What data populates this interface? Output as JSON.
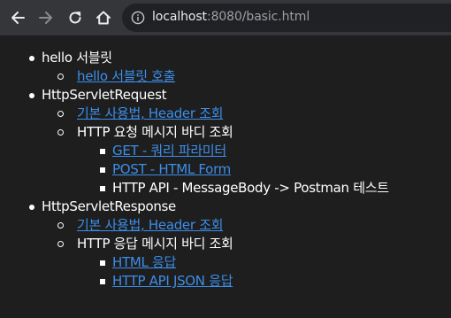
{
  "browser": {
    "url_host": "localhost",
    "url_rest": ":8080/basic.html",
    "icons": {
      "back": "arrow-left",
      "forward": "arrow-right",
      "reload": "reload",
      "home": "home",
      "info": "info-circle"
    }
  },
  "page": {
    "sections": [
      {
        "label": "hello 서블릿",
        "items": [
          {
            "label": "hello 서블릿 호출",
            "link": true
          }
        ]
      },
      {
        "label": "HttpServletRequest",
        "items": [
          {
            "label": "기본 사용법, Header 조회",
            "link": true
          },
          {
            "label": "HTTP 요청 메시지 바디 조회",
            "link": false,
            "items": [
              {
                "label": "GET - 쿼리 파라미터",
                "link": true
              },
              {
                "label": "POST - HTML Form",
                "link": true
              },
              {
                "label": "HTTP API - MessageBody -> Postman 테스트",
                "link": false
              }
            ]
          }
        ]
      },
      {
        "label": "HttpServletResponse",
        "items": [
          {
            "label": "기본 사용법, Header 조회",
            "link": true
          },
          {
            "label": "HTTP 응답 메시지 바디 조회",
            "link": false,
            "items": [
              {
                "label": "HTML 응답",
                "link": true
              },
              {
                "label": "HTTP API JSON 응답",
                "link": true
              }
            ]
          }
        ]
      }
    ]
  },
  "colors": {
    "toolbar_bg": "#35363a",
    "omnibox_bg": "#202124",
    "page_bg": "#1e1e1e",
    "text": "#ffffff",
    "link": "#3b8eea"
  }
}
